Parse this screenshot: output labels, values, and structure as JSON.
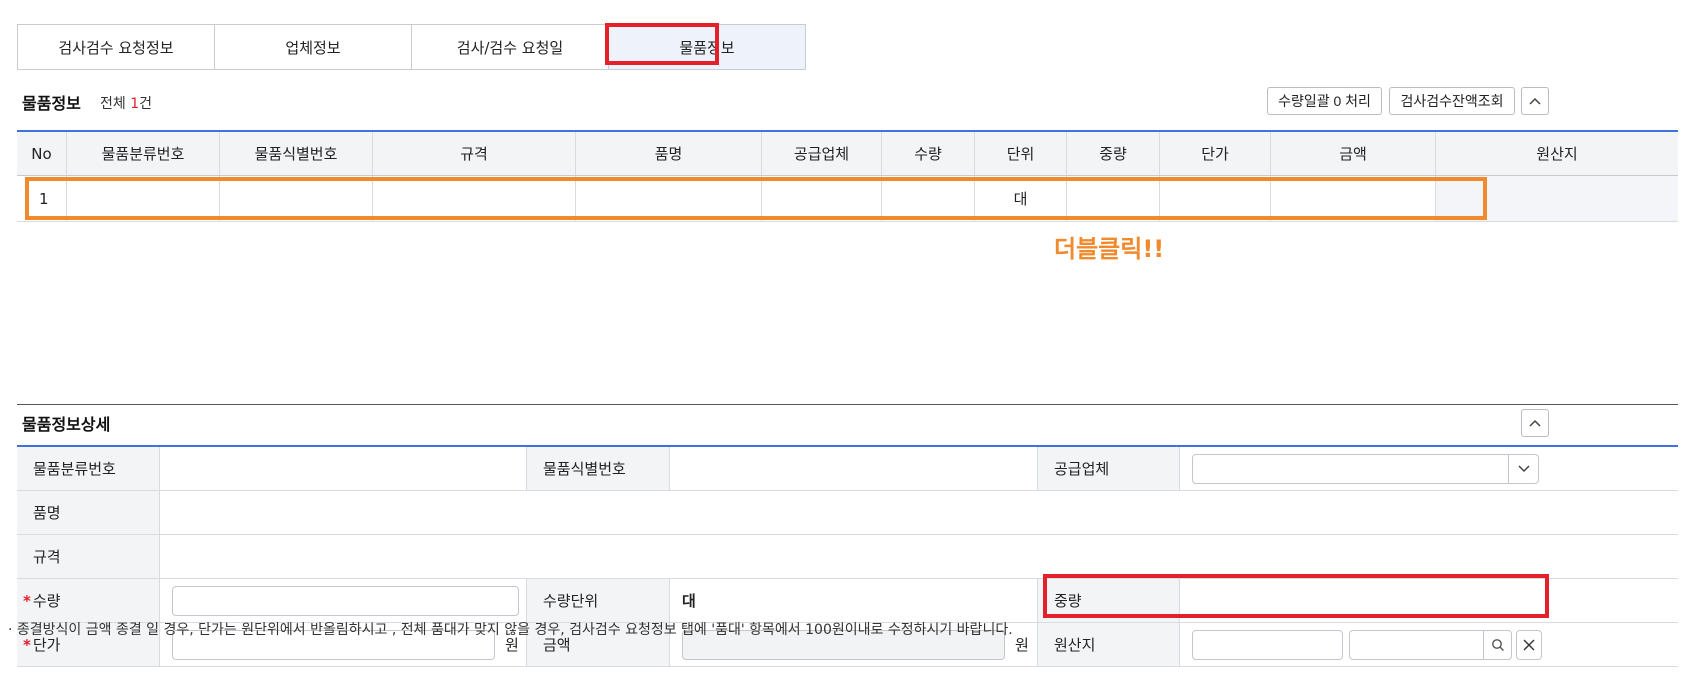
{
  "tabs": [
    "검사검수 요청정보",
    "업체정보",
    "검사/검수 요청일",
    "물품정보"
  ],
  "grid_section": {
    "title": "물품정보",
    "count_prefix": "전체 ",
    "count_num": "1",
    "count_suffix": "건",
    "btn_qty_zero": "수량일괄 0 처리",
    "btn_balance": "검사검수잔액조회",
    "columns": [
      "No",
      "물품분류번호",
      "물품식별번호",
      "규격",
      "품명",
      "공급업체",
      "수량",
      "단위",
      "중량",
      "단가",
      "금액",
      "원산지"
    ],
    "rows": [
      {
        "no": "1",
        "class_no": "",
        "id_no": "",
        "spec": "",
        "name": "",
        "vendor": "",
        "qty": "",
        "unit": "대",
        "weight": "",
        "price": "",
        "amount": "",
        "origin": ""
      }
    ]
  },
  "annotation": "더블클릭!!",
  "detail": {
    "title": "물품정보상세",
    "labels": {
      "class_no": "물품분류번호",
      "id_no": "물품식별번호",
      "vendor": "공급업체",
      "name": "품명",
      "spec": "규격",
      "qty": "수량",
      "qty_unit": "수량단위",
      "weight": "중량",
      "unit_price": "단가",
      "amount": "금액",
      "origin": "원산지"
    },
    "required_mark": "*",
    "values": {
      "class_no": "",
      "id_no": "",
      "name": "",
      "spec": "",
      "qty_unit": "대",
      "weight": ""
    },
    "won": "원"
  },
  "note": "· 종결방식이 금액 종결 일 경우, 단가는 원단위에서 반올림하시고 , 전체 품대가 맞지 않을 경우, 검사검수 요청정보 탭에 '품대' 항목에서 100원이내로 수정하시기 바랍니다.",
  "colors": {
    "accent_blue": "#3f72e0",
    "highlight_red": "#e4202b",
    "highlight_orange": "#f08a2c"
  }
}
